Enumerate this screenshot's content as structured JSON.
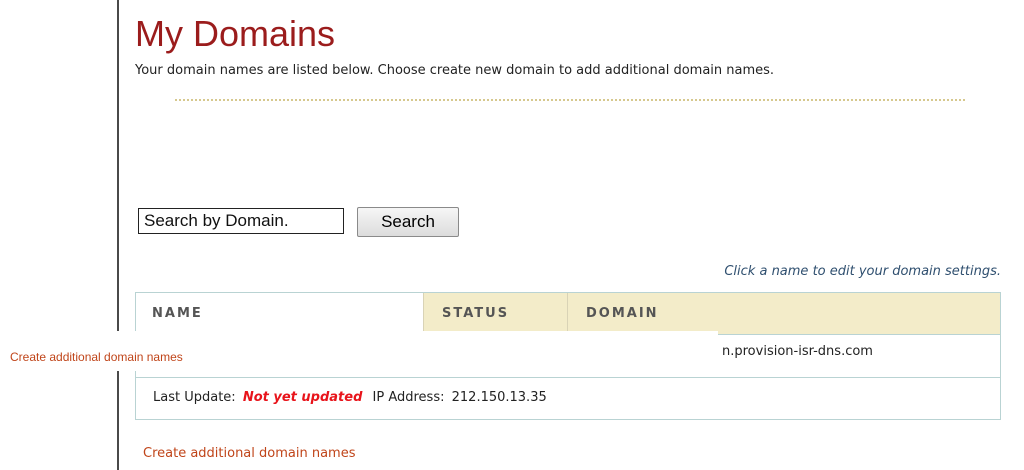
{
  "page": {
    "title": "My Domains",
    "subtitle": "Your domain names are listed below. Choose create new domain to add additional domain names."
  },
  "search": {
    "placeholder": "Search by Domain.",
    "button_label": "Search"
  },
  "hint": "Click a name to edit your domain settings.",
  "table": {
    "columns": [
      "NAME",
      "STATUS",
      "DOMAIN"
    ],
    "rows": [
      {
        "name": "",
        "status": "",
        "domain": "n.provision-isr-dns.com",
        "last_update_label": "Last Update:",
        "last_update_value": "Not yet updated",
        "ip_label": "IP Address:",
        "ip_value": "212.150.13.35"
      }
    ]
  },
  "links": {
    "create_additional_overlay": "Create additional domain names",
    "create_additional": "Create additional domain names"
  },
  "colors": {
    "title": "#9b1c1c",
    "link": "#c0451a",
    "header_bg": "#f3ecc9",
    "alert": "#e8141b"
  }
}
